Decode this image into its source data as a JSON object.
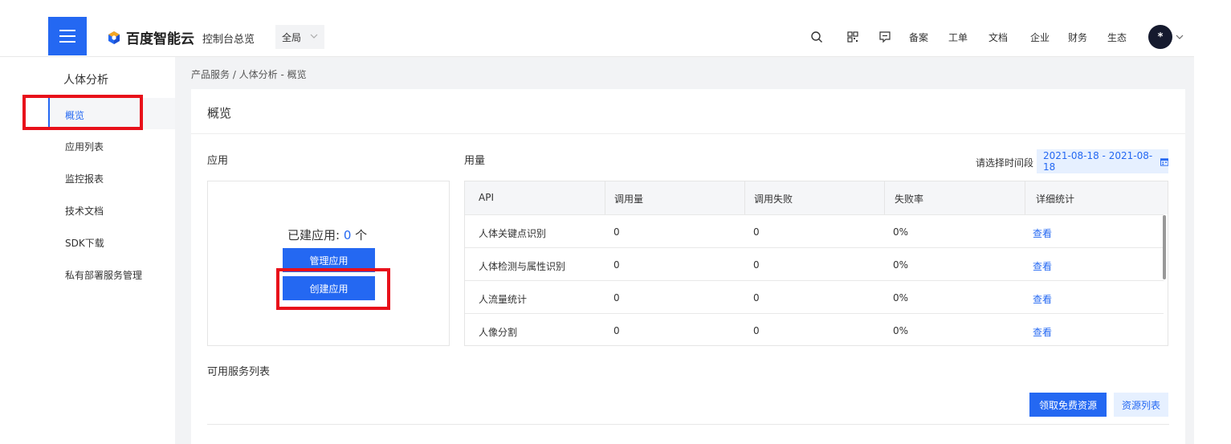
{
  "topbar": {
    "brand": "百度智能云",
    "overview": "控制台总览",
    "region": "全局",
    "links": [
      "备案",
      "工单",
      "文档",
      "企业",
      "财务",
      "生态"
    ],
    "avatar_text": "*",
    "icons": [
      "search-icon",
      "qrcode-icon",
      "message-icon"
    ],
    "accent_color": "#2468f2"
  },
  "sidebar": {
    "title": "人体分析",
    "items": [
      {
        "label": "概览",
        "active": true
      },
      {
        "label": "应用列表"
      },
      {
        "label": "监控报表"
      },
      {
        "label": "技术文档"
      },
      {
        "label": "SDK下载"
      },
      {
        "label": "私有部署服务管理"
      }
    ]
  },
  "breadcrumb": {
    "text": "产品服务 / 人体分析 - 概览"
  },
  "card": {
    "title": "概览",
    "apps_label": "应用",
    "built_prefix": "已建应用: ",
    "built_count": "0",
    "built_suffix": " 个",
    "manage_btn": "管理应用",
    "create_btn": "创建应用",
    "usage_label": "用量",
    "date_label": "请选择时间段",
    "date_range": "2021-08-18 - 2021-08-18",
    "services_label": "可用服务列表",
    "free_btn": "领取免费资源",
    "resource_btn": "资源列表"
  },
  "table": {
    "headers": [
      "API",
      "调用量",
      "调用失败",
      "失败率",
      "详细统计"
    ],
    "rows": [
      {
        "api": "人体关键点识别",
        "calls": "0",
        "fails": "0",
        "rate": "0%",
        "detail": "查看"
      },
      {
        "api": "人体检测与属性识别",
        "calls": "0",
        "fails": "0",
        "rate": "0%",
        "detail": "查看"
      },
      {
        "api": "人流量统计",
        "calls": "0",
        "fails": "0",
        "rate": "0%",
        "detail": "查看"
      },
      {
        "api": "人像分割",
        "calls": "0",
        "fails": "0",
        "rate": "0%",
        "detail": "查看"
      }
    ]
  }
}
